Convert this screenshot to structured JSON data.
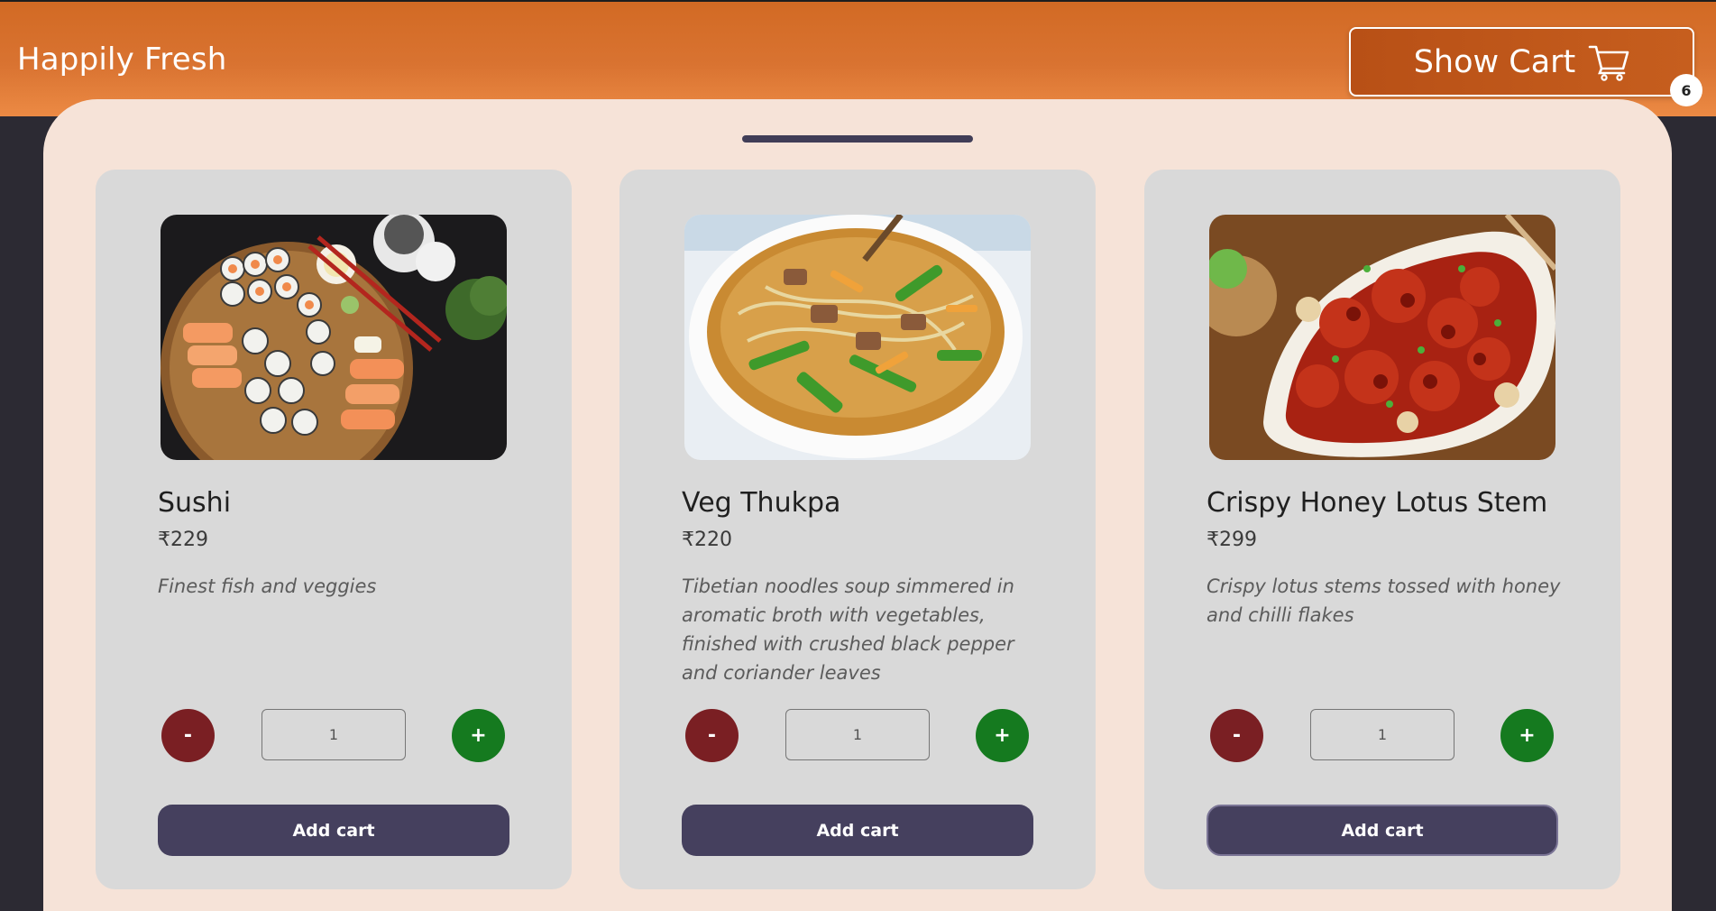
{
  "header": {
    "brand": "Happily Fresh",
    "cart_button_label": "Show Cart",
    "cart_count": "6"
  },
  "products": [
    {
      "name": "Sushi",
      "price": "₹229",
      "description": "Finest fish and veggies",
      "minus_label": "-",
      "quantity": "1",
      "plus_label": "+",
      "add_label": "Add cart"
    },
    {
      "name": "Veg Thukpa",
      "price": "₹220",
      "description": "Tibetian noodles soup simmered in aromatic broth with vegetables, finished with crushed black pepper and coriander leaves",
      "minus_label": "-",
      "quantity": "1",
      "plus_label": "+",
      "add_label": "Add cart"
    },
    {
      "name": "Crispy Honey Lotus Stem",
      "price": "₹299",
      "description": "Crispy lotus stems tossed with honey and chilli flakes",
      "minus_label": "-",
      "quantity": "1",
      "plus_label": "+",
      "add_label": "Add cart"
    }
  ],
  "colors": {
    "header_orange": "#d97331",
    "panel_bg": "#f6e3d8",
    "card_bg": "#d9d9d9",
    "minus_red": "#7a1f23",
    "plus_green": "#157a1f",
    "add_button": "#45405e"
  },
  "icons": {
    "cart": "shopping-cart-icon"
  }
}
